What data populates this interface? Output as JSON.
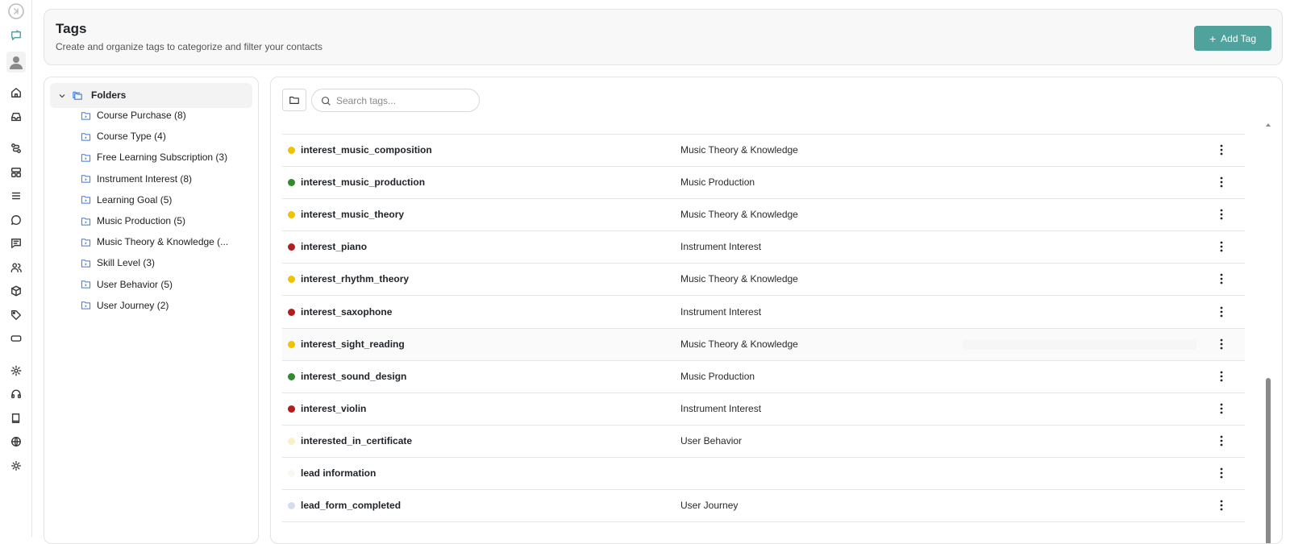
{
  "nav": {
    "icons": [
      "sidebar-toggle-icon",
      "chat-icon",
      "avatar",
      "home-icon",
      "inbox-icon",
      "workflow-icon",
      "layout-icon",
      "list-icon",
      "message-icon",
      "comments-icon",
      "users-icon",
      "box-icon",
      "tag-icon",
      "ticket-icon",
      "settings-icon",
      "headset-icon",
      "book-icon",
      "globe-icon",
      "theme-icon"
    ]
  },
  "header": {
    "title": "Tags",
    "subtitle": "Create and organize tags to categorize and filter your contacts",
    "add_button": "Add Tag"
  },
  "folders": {
    "root_label": "Folders",
    "items": [
      "Course Purchase (8)",
      "Course Type (4)",
      "Free Learning Subscription (3)",
      "Instrument Interest (8)",
      "Learning Goal (5)",
      "Music Production (5)",
      "Music Theory & Knowledge (...",
      "Skill Level (3)",
      "User Behavior (5)",
      "User Journey (2)"
    ]
  },
  "search": {
    "placeholder": "Search tags...",
    "value": ""
  },
  "colors": {
    "accent": "#4fa39c",
    "yellow": "#f2c200",
    "green": "#2e8b2e",
    "red": "#b01e1e",
    "pale_yellow": "#f7f0c8",
    "very_pale": "#faf7f3",
    "pale_blue": "#d3dcf3"
  },
  "tags": [
    {
      "name": "interest_music_composition",
      "folder": "Music Theory & Knowledge",
      "color": "#f2c200"
    },
    {
      "name": "interest_music_production",
      "folder": "Music Production",
      "color": "#2e8b2e"
    },
    {
      "name": "interest_music_theory",
      "folder": "Music Theory & Knowledge",
      "color": "#f2c200"
    },
    {
      "name": "interest_piano",
      "folder": "Instrument Interest",
      "color": "#b01e1e"
    },
    {
      "name": "interest_rhythm_theory",
      "folder": "Music Theory & Knowledge",
      "color": "#f2c200"
    },
    {
      "name": "interest_saxophone",
      "folder": "Instrument Interest",
      "color": "#b01e1e"
    },
    {
      "name": "interest_sight_reading",
      "folder": "Music Theory & Knowledge",
      "color": "#f2c200"
    },
    {
      "name": "interest_sound_design",
      "folder": "Music Production",
      "color": "#2e8b2e"
    },
    {
      "name": "interest_violin",
      "folder": "Instrument Interest",
      "color": "#b01e1e"
    },
    {
      "name": "interested_in_certificate",
      "folder": "User Behavior",
      "color": "#f7f0c8"
    },
    {
      "name": "lead information",
      "folder": "",
      "color": "#faf7f3"
    },
    {
      "name": "lead_form_completed",
      "folder": "User Journey",
      "color": "#d3dcf3"
    }
  ]
}
